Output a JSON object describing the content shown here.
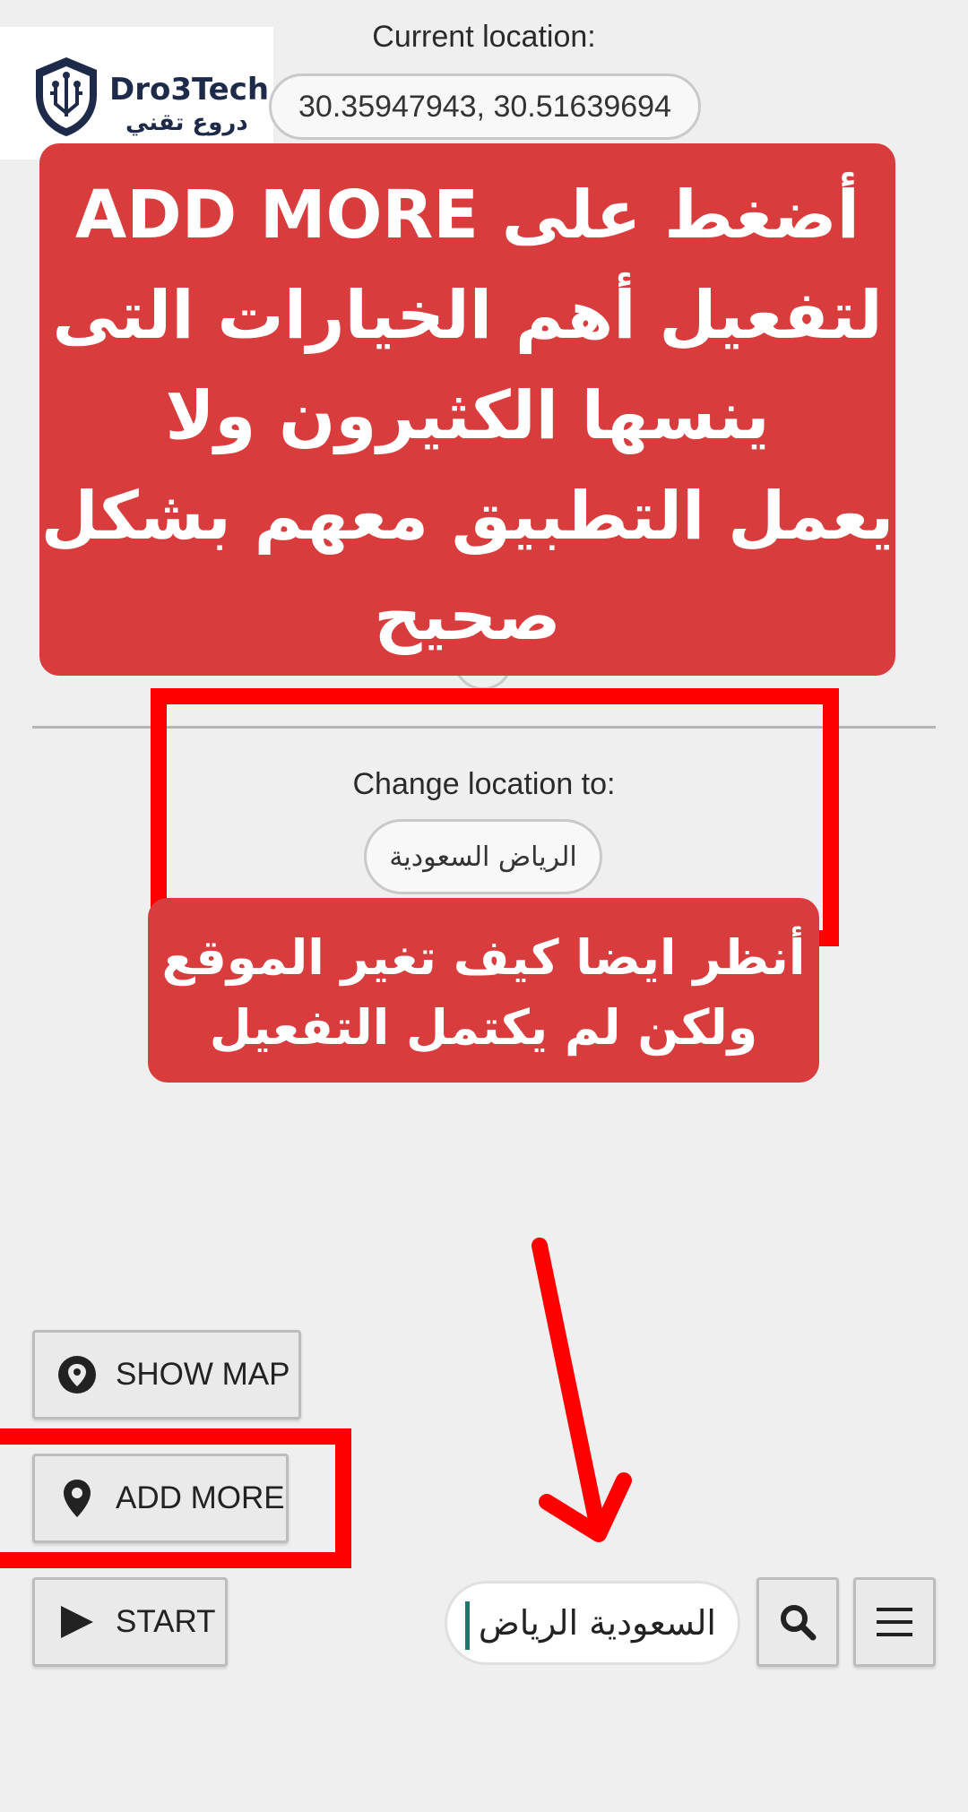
{
  "logo": {
    "name_en": "Dro3Tech",
    "name_ar": "دروع تقني",
    "icon": "shield-circuit-icon",
    "colors": {
      "navy": "#1d2a4a"
    }
  },
  "current_location": {
    "label": "Current location:",
    "value": "30.35947943, 30.51639694"
  },
  "callouts": {
    "top_lines": [
      "أضغط على ADD MORE",
      "لتفعيل أهم الخيارات التى",
      "ينسها الكثيرون ولا",
      "يعمل التطبيق معهم بشكل",
      "صحيح"
    ],
    "mid_lines": [
      "أنظر ايضا كيف تغير الموقع",
      "ولكن لم يكتمل التفعيل"
    ],
    "color": "#d93c3c"
  },
  "change_location": {
    "label": "Change location to:",
    "value": "الرياض السعودية"
  },
  "buttons": {
    "show_map": {
      "label": "SHOW MAP",
      "icon": "map-pin-filled-icon"
    },
    "add_more": {
      "label": "ADD MORE",
      "icon": "map-pin-outline-icon"
    },
    "start": {
      "label": "START",
      "icon": "play-icon"
    }
  },
  "search": {
    "value": "السعودية الرياض",
    "search_icon": "search-icon",
    "menu_icon": "hamburger-menu-icon"
  },
  "highlight_color": "#ff0000"
}
